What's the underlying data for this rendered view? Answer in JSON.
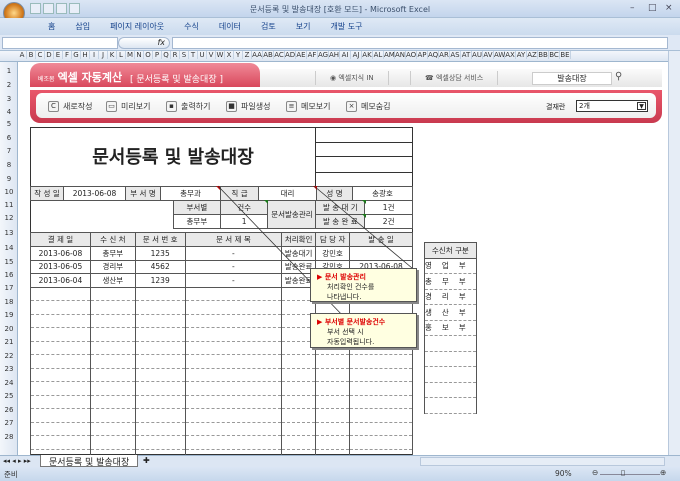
{
  "window": {
    "title": "문서등록 및 발송대장  [호환 모드] - Microsoft Excel"
  },
  "ribbon_tabs": [
    "홈",
    "삽입",
    "페이지 레이아웃",
    "수식",
    "데이터",
    "검토",
    "보기",
    "개발 도구"
  ],
  "formula": {
    "fx": "fx",
    "value": ""
  },
  "columns": [
    "A",
    "B",
    "C",
    "D",
    "E",
    "F",
    "G",
    "H",
    "I",
    "J",
    "K",
    "L",
    "M",
    "N",
    "O",
    "P",
    "Q",
    "R",
    "S",
    "T",
    "U",
    "V",
    "W",
    "X",
    "Y",
    "Z",
    "AA",
    "AB",
    "AC",
    "AD",
    "AE",
    "AF",
    "AG",
    "AH",
    "AI",
    "AJ",
    "AK",
    "AL",
    "AM",
    "AN",
    "AO",
    "AP",
    "AQ",
    "AR",
    "AS",
    "AT",
    "AU",
    "AV",
    "AW",
    "AX",
    "AY",
    "AZ",
    "BB",
    "BC",
    "BE"
  ],
  "rows": [
    "1",
    "2",
    "3",
    "4",
    "5",
    "6",
    "7",
    "8",
    "9",
    "10",
    "11",
    "12",
    "13",
    "14",
    "15",
    "16",
    "17",
    "18",
    "19",
    "20",
    "21",
    "22",
    "23",
    "24",
    "25",
    "26",
    "27",
    "28"
  ],
  "banner": {
    "logo_small": "베조몸",
    "logo": "엑셀 자동계산",
    "subtitle": "[ 문서등록 및 발송대장 ]",
    "link1": "◉ 엑셀지식 IN",
    "link2": "☎ 엑셀상담 서비스",
    "search_value": "발송대장",
    "buttons": [
      "새로작성",
      "미리보기",
      "출력하기",
      "파일생성",
      "메모보기",
      "메모숨김"
    ],
    "approval_label": "결재란",
    "approval_value": "2개"
  },
  "doc": {
    "title": "문서등록 및 발송대장",
    "info": {
      "date_label": "작 성 일",
      "date": "2013-06-08",
      "dept_label": "부 서 명",
      "dept": "총무과",
      "rank_label": "직   급",
      "rank": "대리",
      "name_label": "성   명",
      "name": "송광호"
    },
    "summary": {
      "by_dept_label": "부서별",
      "count_label": "건수",
      "dept": "총무부",
      "count": "1",
      "mgmt_label": "문서발송관리",
      "wait_label": "발 송 대 기",
      "wait": "1건",
      "done_label": "발 송 완 료",
      "done": "2건"
    },
    "headers": [
      "결 제 일",
      "수 신 처",
      "문 서 번 호",
      "문   서   제   목",
      "처리확인",
      "담 당 자",
      "발   송   일"
    ],
    "records": [
      [
        "2013-06-08",
        "총무부",
        "1235",
        "-",
        "발송대기",
        "강민호",
        ""
      ],
      [
        "2013-06-05",
        "경리부",
        "4562",
        "-",
        "발송완료",
        "강민호",
        "2013-06-08"
      ],
      [
        "2013-06-04",
        "생산부",
        "1239",
        "-",
        "발송완료",
        "",
        ""
      ]
    ]
  },
  "recipients": {
    "header": "수신처 구분",
    "items": [
      "영업부",
      "총무부",
      "경리부",
      "생산부",
      "홍보부"
    ]
  },
  "notes": [
    {
      "title": "▶ 문서 발송관리",
      "lines": [
        "처리확인 건수를",
        "나타냅니다."
      ]
    },
    {
      "title": "▶ 부서별 문서발송건수",
      "lines": [
        "부서 선택 시",
        "자동입력됩니다."
      ]
    }
  ],
  "sheet_tab": "문서등록 및 발송대장",
  "status": {
    "ready": "준비",
    "zoom": "90%"
  }
}
